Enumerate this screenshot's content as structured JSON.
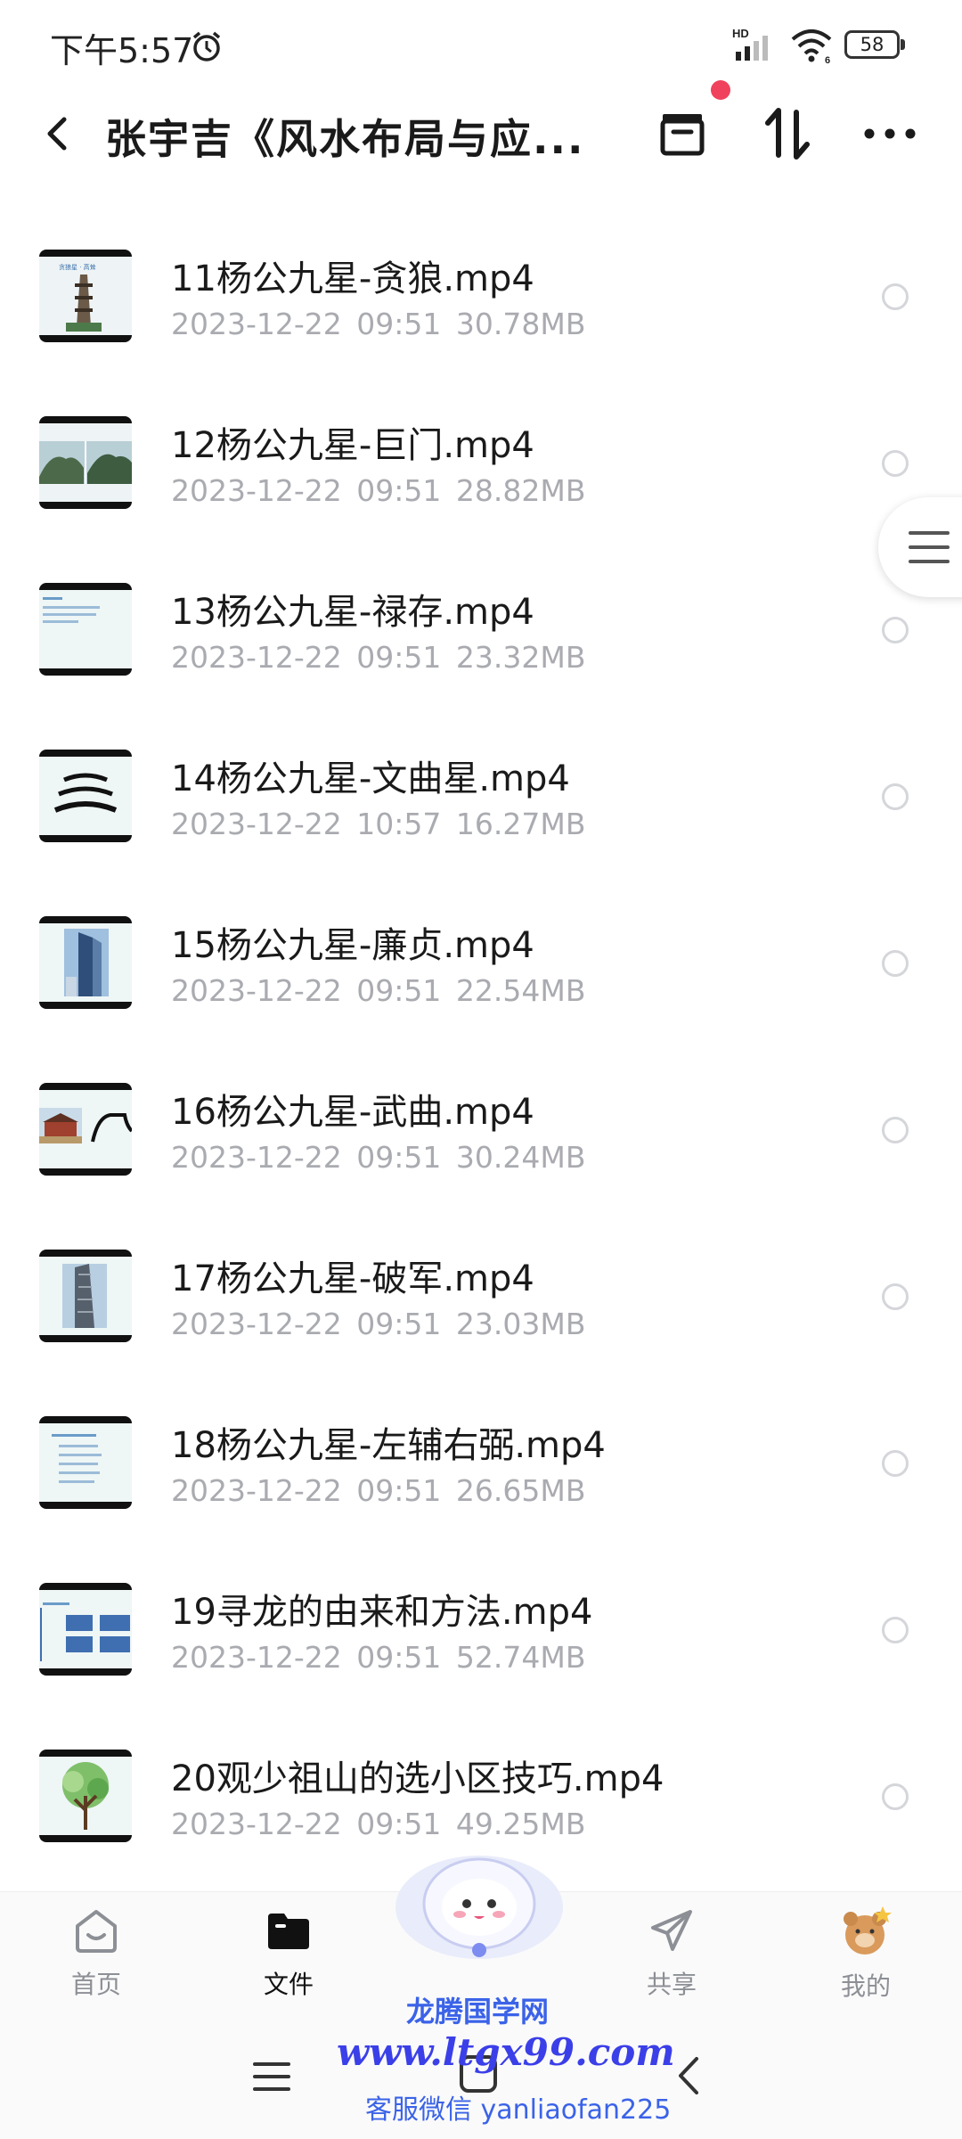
{
  "status_bar": {
    "time": "下午5:57",
    "battery": "58",
    "icons": [
      "alarm-icon",
      "hd-signal-icon",
      "wifi-icon",
      "battery-icon"
    ]
  },
  "header": {
    "title": "张宇吉《风水布局与应...",
    "icons": [
      "back-icon",
      "archive-icon",
      "sort-icon",
      "more-icon"
    ]
  },
  "files": [
    {
      "name": "11杨公九星-贪狼.mp4",
      "date": "2023-12-22",
      "time": "09:51",
      "size": "30.78MB"
    },
    {
      "name": "12杨公九星-巨门.mp4",
      "date": "2023-12-22",
      "time": "09:51",
      "size": "28.82MB"
    },
    {
      "name": "13杨公九星-禄存.mp4",
      "date": "2023-12-22",
      "time": "09:51",
      "size": "23.32MB"
    },
    {
      "name": "14杨公九星-文曲星.mp4",
      "date": "2023-12-22",
      "time": "10:57",
      "size": "16.27MB"
    },
    {
      "name": "15杨公九星-廉贞.mp4",
      "date": "2023-12-22",
      "time": "09:51",
      "size": "22.54MB"
    },
    {
      "name": "16杨公九星-武曲.mp4",
      "date": "2023-12-22",
      "time": "09:51",
      "size": "30.24MB"
    },
    {
      "name": "17杨公九星-破军.mp4",
      "date": "2023-12-22",
      "time": "09:51",
      "size": "23.03MB"
    },
    {
      "name": "18杨公九星-左辅右弼.mp4",
      "date": "2023-12-22",
      "time": "09:51",
      "size": "26.65MB"
    },
    {
      "name": "19寻龙的由来和方法.mp4",
      "date": "2023-12-22",
      "time": "09:51",
      "size": "52.74MB"
    },
    {
      "name": "20观少祖山的选小区技巧.mp4",
      "date": "2023-12-22",
      "time": "09:51",
      "size": "49.25MB"
    }
  ],
  "bottom_nav": {
    "items": [
      {
        "label": "首页",
        "icon": "home-icon"
      },
      {
        "label": "文件",
        "icon": "folder-icon",
        "active": true
      },
      {
        "label": "",
        "icon": "mascot-icon"
      },
      {
        "label": "共享",
        "icon": "share-icon"
      },
      {
        "label": "我的",
        "icon": "profile-avatar-icon"
      }
    ]
  },
  "watermark": {
    "name": "龙腾国学网",
    "url": "www.ltgx99.com",
    "contact": "客服微信 yanliaofan225"
  },
  "colors": {
    "accent_red": "#f0425c",
    "meta_gray": "#a9abb0",
    "watermark_blue": "#3b3fe8"
  }
}
